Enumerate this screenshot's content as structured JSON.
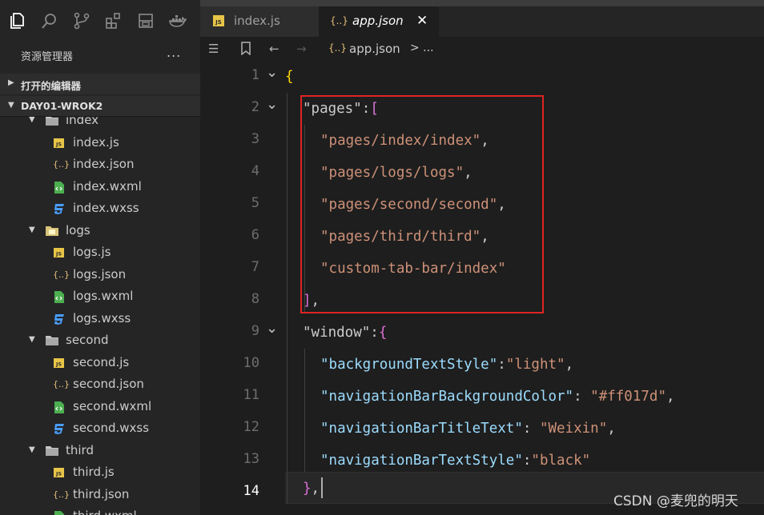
{
  "sidebar": {
    "title": "资源管理器",
    "more": "...",
    "open_editors": "打开的编辑器",
    "project": "DAY01-WROK2",
    "tree": [
      {
        "label": "index",
        "kind": "folder",
        "depth": 1
      },
      {
        "label": "index.js",
        "kind": "js",
        "depth": 2
      },
      {
        "label": "index.json",
        "kind": "json",
        "depth": 2
      },
      {
        "label": "index.wxml",
        "kind": "wxml",
        "depth": 2
      },
      {
        "label": "index.wxss",
        "kind": "wxss",
        "depth": 2
      },
      {
        "label": "logs",
        "kind": "folder-active",
        "depth": 1
      },
      {
        "label": "logs.js",
        "kind": "js",
        "depth": 2
      },
      {
        "label": "logs.json",
        "kind": "json",
        "depth": 2
      },
      {
        "label": "logs.wxml",
        "kind": "wxml",
        "depth": 2
      },
      {
        "label": "logs.wxss",
        "kind": "wxss",
        "depth": 2
      },
      {
        "label": "second",
        "kind": "folder",
        "depth": 1
      },
      {
        "label": "second.js",
        "kind": "js",
        "depth": 2
      },
      {
        "label": "second.json",
        "kind": "json",
        "depth": 2
      },
      {
        "label": "second.wxml",
        "kind": "wxml",
        "depth": 2
      },
      {
        "label": "second.wxss",
        "kind": "wxss",
        "depth": 2
      },
      {
        "label": "third",
        "kind": "folder",
        "depth": 1
      },
      {
        "label": "third.js",
        "kind": "js",
        "depth": 2
      },
      {
        "label": "third.json",
        "kind": "json",
        "depth": 2
      },
      {
        "label": "third.wxml",
        "kind": "wxml",
        "depth": 2
      }
    ]
  },
  "tabs": {
    "index": "index.js",
    "app": "app.json",
    "close": "✕"
  },
  "breadcrumb": {
    "file": "app.json",
    "more": "> ..."
  },
  "icons": {
    "js": "JS",
    "json": "{..}"
  },
  "line_numbers": [
    "1",
    "2",
    "3",
    "4",
    "5",
    "6",
    "7",
    "8",
    "9",
    "10",
    "11",
    "12",
    "13",
    "14"
  ],
  "active_line": "14",
  "code": {
    "l1_open": "{",
    "l2_key": "\"pages\"",
    "l2_colon": ":",
    "l2_bracket": "[",
    "l3": "\"pages/index/index\"",
    "l4": "\"pages/logs/logs\"",
    "l5": "\"pages/second/second\"",
    "l6": "\"pages/third/third\"",
    "l7": "\"custom-tab-bar/index\"",
    "comma": ",",
    "l8_bracket": "]",
    "l9_key": "\"window\"",
    "l9_colon": ":",
    "l9_brace": "{",
    "l10_key": "\"backgroundTextStyle\"",
    "l10_val": "\"light\"",
    "l11_key": "\"navigationBarBackgroundColor\"",
    "l11_val": "\"#ff017d\"",
    "l12_key": "\"navigationBarTitleText\"",
    "l12_val": "\"Weixin\"",
    "l13_key": "\"navigationBarTextStyle\"",
    "l13_val": "\"black\"",
    "l14_brace": "}"
  },
  "watermark": "CSDN @麦兜的明天",
  "colors": {
    "highlight_box": "#e02424",
    "key": "#9cdcfe",
    "string": "#ce9178"
  }
}
